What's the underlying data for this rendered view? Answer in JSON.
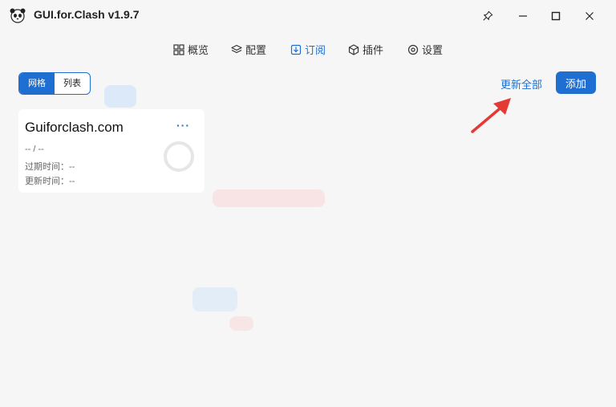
{
  "window": {
    "title": "GUI.for.Clash v1.9.7",
    "logo_icon": "panda-icon",
    "controls": [
      "pin-icon",
      "minimize-icon",
      "maximize-icon",
      "close-icon"
    ]
  },
  "nav": {
    "items": [
      {
        "label": "概览",
        "icon": "grid-icon"
      },
      {
        "label": "配置",
        "icon": "layers-icon"
      },
      {
        "label": "订阅",
        "icon": "subscribe-icon",
        "active": true
      },
      {
        "label": "插件",
        "icon": "cube-icon"
      },
      {
        "label": "设置",
        "icon": "settings-icon"
      }
    ]
  },
  "toolbar": {
    "view_grid": "网格",
    "view_list": "列表",
    "update_all": "更新全部",
    "add": "添加"
  },
  "card": {
    "title": "Guiforclash.com",
    "more": "···",
    "traffic": "-- / --",
    "expire": "过期时间：--",
    "updated": "更新时间：--"
  },
  "colors": {
    "accent": "#1e6fd1",
    "annotation_arrow": "#e53935"
  }
}
